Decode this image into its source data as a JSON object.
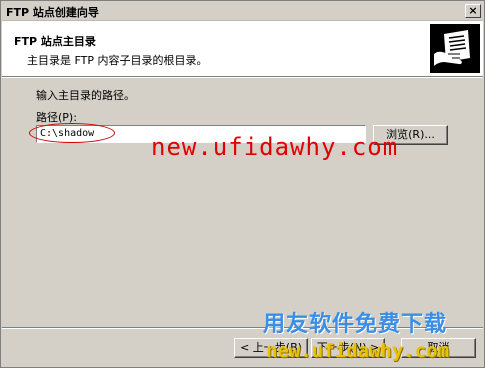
{
  "window": {
    "title": "FTP 站点创建向导",
    "close_glyph": "×"
  },
  "header": {
    "title": "FTP 站点主目录",
    "subtitle": "主目录是 FTP 内容子目录的根目录。",
    "icon": "wizard-hand-document-icon"
  },
  "form": {
    "prompt": "输入主目录的路径。",
    "path_label": "路径",
    "path_accesskey_display": "(P):",
    "path_value": "C:\\shadow",
    "browse_label": "浏览(R)..."
  },
  "buttons": {
    "back_label": "< 上一步(B)",
    "next_label": "下一步(N) >",
    "cancel_label": "取消"
  },
  "watermarks": {
    "main": "new.ufidawhy.com",
    "brand_cn": "用友软件免费下载",
    "brand_url": "new.ufidawhy.com"
  },
  "colors": {
    "dialog_bg": "#d4d0c8",
    "header_bg": "#ffffff",
    "annotation_red": "#d00000",
    "watermark_red": "#e00000",
    "watermark_blue": "#3a8ee6",
    "watermark_yellow": "#e8c200"
  }
}
